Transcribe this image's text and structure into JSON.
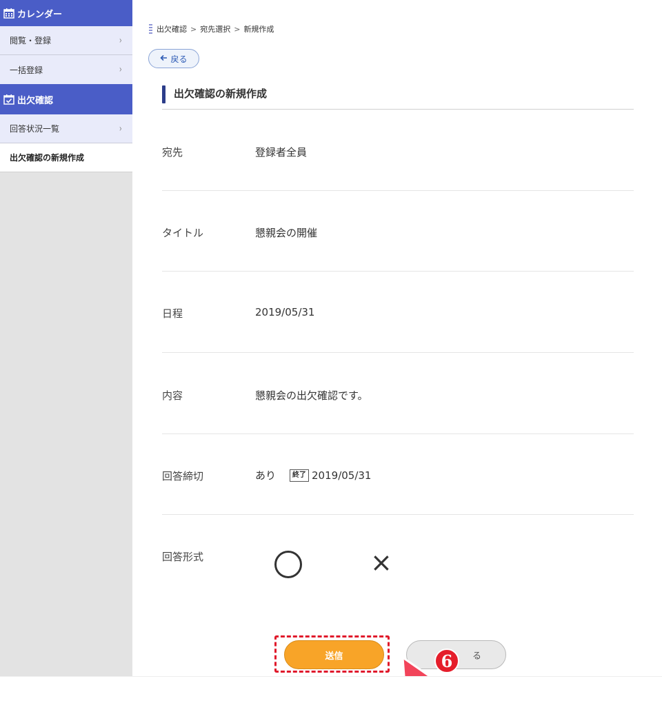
{
  "sidebar": {
    "calendar_header": "カレンダー",
    "calendar_items": [
      {
        "label": "閲覧・登録",
        "chevron": "›"
      },
      {
        "label": "一括登録",
        "chevron": "›"
      }
    ],
    "attendance_header": "出欠確認",
    "attendance_items": [
      {
        "label": "回答状況一覧",
        "chevron": "›"
      },
      {
        "label": "出欠確認の新規作成",
        "active": true
      }
    ]
  },
  "breadcrumb": {
    "items": [
      "出欠確認",
      "宛先選択",
      "新規作成"
    ],
    "separator": ">"
  },
  "back_button": {
    "label": "戻る",
    "icon": "arrow-left-icon"
  },
  "page_title": "出欠確認の新規作成",
  "form": {
    "recipient": {
      "label": "宛先",
      "value": "登録者全員"
    },
    "title": {
      "label": "タイトル",
      "value": "懇親会の開催"
    },
    "schedule": {
      "label": "日程",
      "value": "2019/05/31"
    },
    "content": {
      "label": "内容",
      "value": "懇親会の出欠確認です。"
    },
    "deadline": {
      "label": "回答締切",
      "value": "あり",
      "tag": "終了",
      "date": "2019/05/31"
    },
    "answer_format": {
      "label": "回答形式",
      "options": [
        "○",
        "×"
      ]
    }
  },
  "buttons": {
    "send": "送信",
    "close": "る"
  },
  "annotation": {
    "step": "6"
  },
  "colors": {
    "sidebar_header": "#4a5dc7",
    "send": "#f8a428",
    "highlight": "#e0182b"
  }
}
